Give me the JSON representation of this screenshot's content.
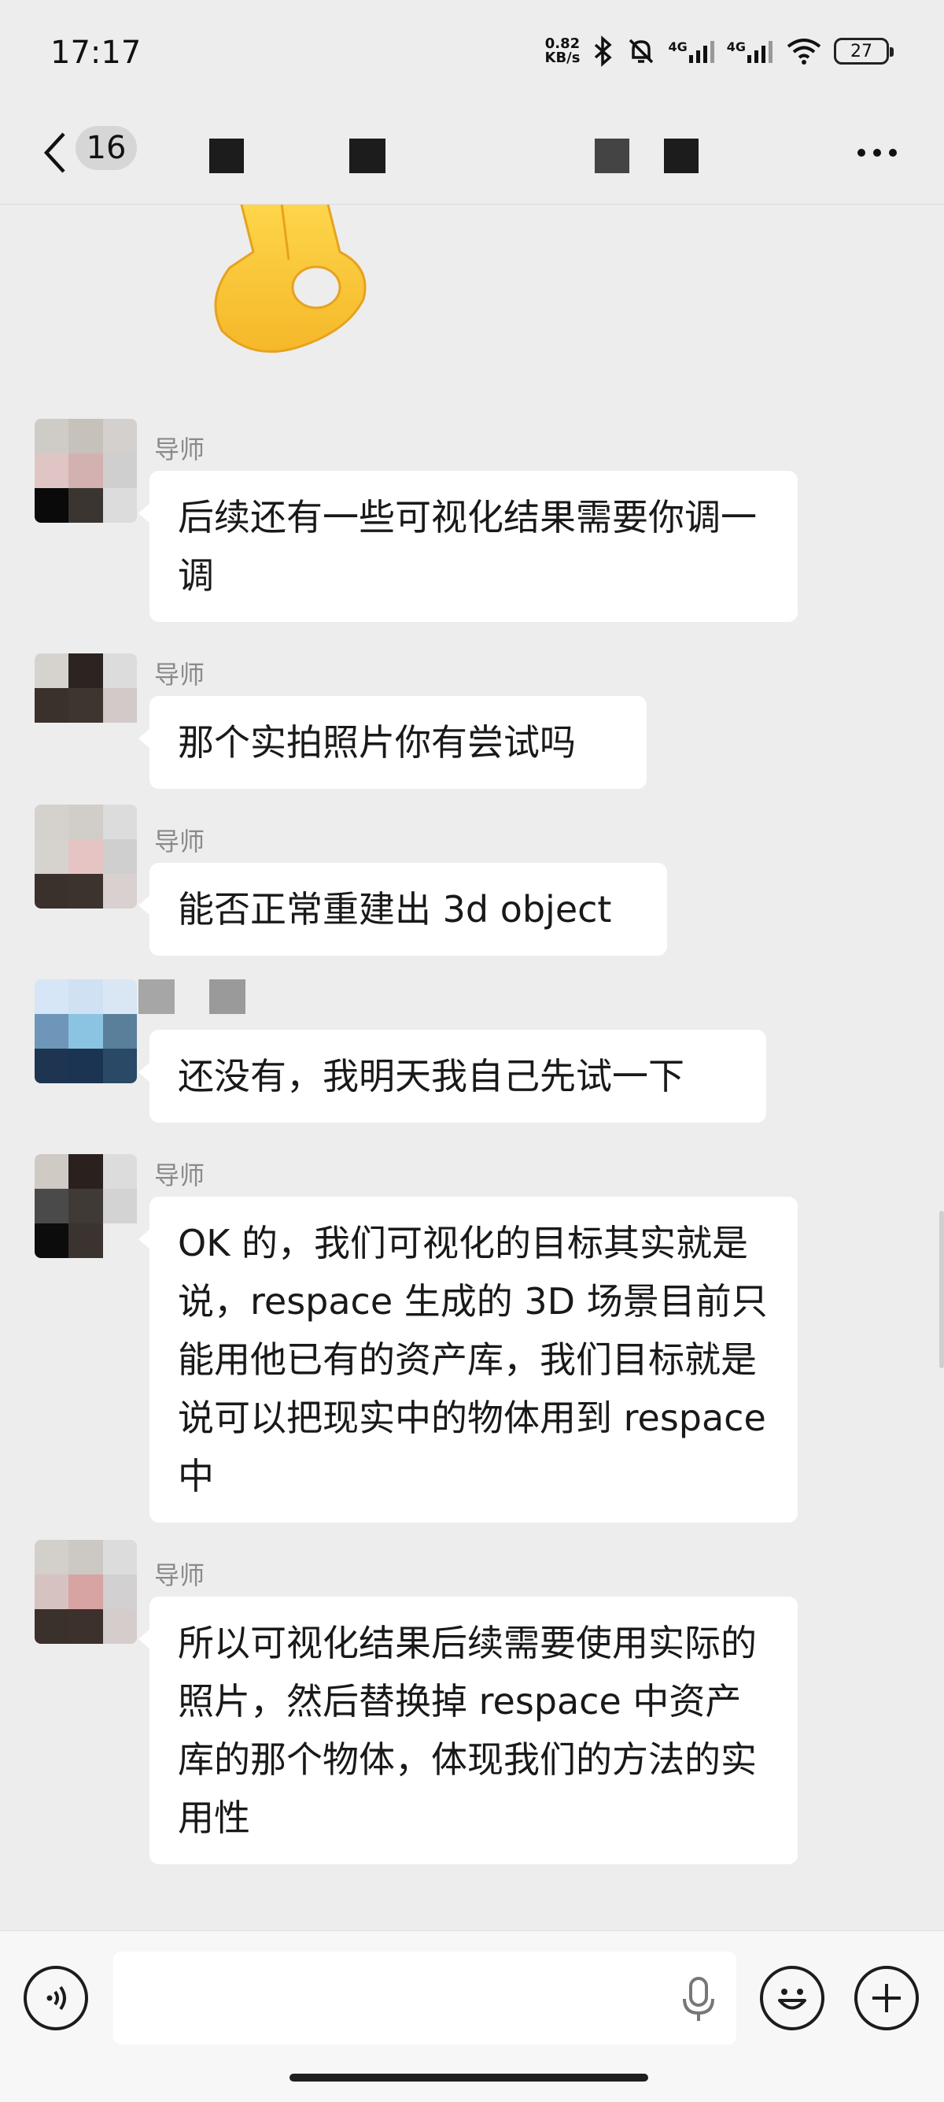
{
  "status_bar": {
    "time": "17:17",
    "net_speed_value": "0.82",
    "net_speed_unit": "KB/s",
    "signal1_label": "4G",
    "signal2_label": "4G",
    "battery": "27"
  },
  "nav": {
    "unread_count": "16",
    "back_icon": "chevron-left-icon",
    "more_icon": "more-dots-icon"
  },
  "messages": [
    {
      "sender": "导师",
      "text": "后续还有一些可视化结果需要你调一调"
    },
    {
      "sender": "导师",
      "text": "那个实拍照片你有尝试吗"
    },
    {
      "sender": "导师",
      "text": "能否正常重建出 3d object"
    },
    {
      "sender": "",
      "text": "还没有，我明天我自己先试一下"
    },
    {
      "sender": "导师",
      "text": "OK 的，我们可视化的目标其实就是说，respace 生成的 3D 场景目前只能用他已有的资产库，我们目标就是说可以把现实中的物体用到 respace 中"
    },
    {
      "sender": "导师",
      "text": "所以可视化结果后续需要使用实际的照片，然后替换掉 respace 中资产库的那个物体，体现我们的方法的实用性"
    }
  ],
  "input_bar": {
    "voice_icon": "voice-icon",
    "mic_icon": "microphone-icon",
    "emoji_icon": "emoji-icon",
    "plus_icon": "plus-icon"
  },
  "colors": {
    "background": "#ededed",
    "bubble": "#ffffff",
    "sender_name": "#8a8a8a"
  }
}
